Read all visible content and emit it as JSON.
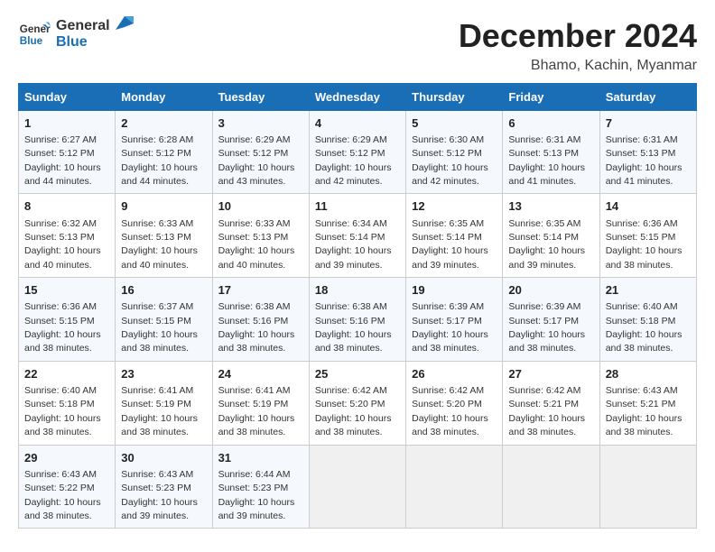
{
  "logo": {
    "line1": "General",
    "line2": "Blue"
  },
  "title": "December 2024",
  "location": "Bhamo, Kachin, Myanmar",
  "days_of_week": [
    "Sunday",
    "Monday",
    "Tuesday",
    "Wednesday",
    "Thursday",
    "Friday",
    "Saturday"
  ],
  "weeks": [
    [
      {
        "day": "1",
        "detail": "Sunrise: 6:27 AM\nSunset: 5:12 PM\nDaylight: 10 hours and 44 minutes."
      },
      {
        "day": "2",
        "detail": "Sunrise: 6:28 AM\nSunset: 5:12 PM\nDaylight: 10 hours and 44 minutes."
      },
      {
        "day": "3",
        "detail": "Sunrise: 6:29 AM\nSunset: 5:12 PM\nDaylight: 10 hours and 43 minutes."
      },
      {
        "day": "4",
        "detail": "Sunrise: 6:29 AM\nSunset: 5:12 PM\nDaylight: 10 hours and 42 minutes."
      },
      {
        "day": "5",
        "detail": "Sunrise: 6:30 AM\nSunset: 5:12 PM\nDaylight: 10 hours and 42 minutes."
      },
      {
        "day": "6",
        "detail": "Sunrise: 6:31 AM\nSunset: 5:13 PM\nDaylight: 10 hours and 41 minutes."
      },
      {
        "day": "7",
        "detail": "Sunrise: 6:31 AM\nSunset: 5:13 PM\nDaylight: 10 hours and 41 minutes."
      }
    ],
    [
      {
        "day": "8",
        "detail": "Sunrise: 6:32 AM\nSunset: 5:13 PM\nDaylight: 10 hours and 40 minutes."
      },
      {
        "day": "9",
        "detail": "Sunrise: 6:33 AM\nSunset: 5:13 PM\nDaylight: 10 hours and 40 minutes."
      },
      {
        "day": "10",
        "detail": "Sunrise: 6:33 AM\nSunset: 5:13 PM\nDaylight: 10 hours and 40 minutes."
      },
      {
        "day": "11",
        "detail": "Sunrise: 6:34 AM\nSunset: 5:14 PM\nDaylight: 10 hours and 39 minutes."
      },
      {
        "day": "12",
        "detail": "Sunrise: 6:35 AM\nSunset: 5:14 PM\nDaylight: 10 hours and 39 minutes."
      },
      {
        "day": "13",
        "detail": "Sunrise: 6:35 AM\nSunset: 5:14 PM\nDaylight: 10 hours and 39 minutes."
      },
      {
        "day": "14",
        "detail": "Sunrise: 6:36 AM\nSunset: 5:15 PM\nDaylight: 10 hours and 38 minutes."
      }
    ],
    [
      {
        "day": "15",
        "detail": "Sunrise: 6:36 AM\nSunset: 5:15 PM\nDaylight: 10 hours and 38 minutes."
      },
      {
        "day": "16",
        "detail": "Sunrise: 6:37 AM\nSunset: 5:15 PM\nDaylight: 10 hours and 38 minutes."
      },
      {
        "day": "17",
        "detail": "Sunrise: 6:38 AM\nSunset: 5:16 PM\nDaylight: 10 hours and 38 minutes."
      },
      {
        "day": "18",
        "detail": "Sunrise: 6:38 AM\nSunset: 5:16 PM\nDaylight: 10 hours and 38 minutes."
      },
      {
        "day": "19",
        "detail": "Sunrise: 6:39 AM\nSunset: 5:17 PM\nDaylight: 10 hours and 38 minutes."
      },
      {
        "day": "20",
        "detail": "Sunrise: 6:39 AM\nSunset: 5:17 PM\nDaylight: 10 hours and 38 minutes."
      },
      {
        "day": "21",
        "detail": "Sunrise: 6:40 AM\nSunset: 5:18 PM\nDaylight: 10 hours and 38 minutes."
      }
    ],
    [
      {
        "day": "22",
        "detail": "Sunrise: 6:40 AM\nSunset: 5:18 PM\nDaylight: 10 hours and 38 minutes."
      },
      {
        "day": "23",
        "detail": "Sunrise: 6:41 AM\nSunset: 5:19 PM\nDaylight: 10 hours and 38 minutes."
      },
      {
        "day": "24",
        "detail": "Sunrise: 6:41 AM\nSunset: 5:19 PM\nDaylight: 10 hours and 38 minutes."
      },
      {
        "day": "25",
        "detail": "Sunrise: 6:42 AM\nSunset: 5:20 PM\nDaylight: 10 hours and 38 minutes."
      },
      {
        "day": "26",
        "detail": "Sunrise: 6:42 AM\nSunset: 5:20 PM\nDaylight: 10 hours and 38 minutes."
      },
      {
        "day": "27",
        "detail": "Sunrise: 6:42 AM\nSunset: 5:21 PM\nDaylight: 10 hours and 38 minutes."
      },
      {
        "day": "28",
        "detail": "Sunrise: 6:43 AM\nSunset: 5:21 PM\nDaylight: 10 hours and 38 minutes."
      }
    ],
    [
      {
        "day": "29",
        "detail": "Sunrise: 6:43 AM\nSunset: 5:22 PM\nDaylight: 10 hours and 38 minutes."
      },
      {
        "day": "30",
        "detail": "Sunrise: 6:43 AM\nSunset: 5:23 PM\nDaylight: 10 hours and 39 minutes."
      },
      {
        "day": "31",
        "detail": "Sunrise: 6:44 AM\nSunset: 5:23 PM\nDaylight: 10 hours and 39 minutes."
      },
      null,
      null,
      null,
      null
    ]
  ]
}
